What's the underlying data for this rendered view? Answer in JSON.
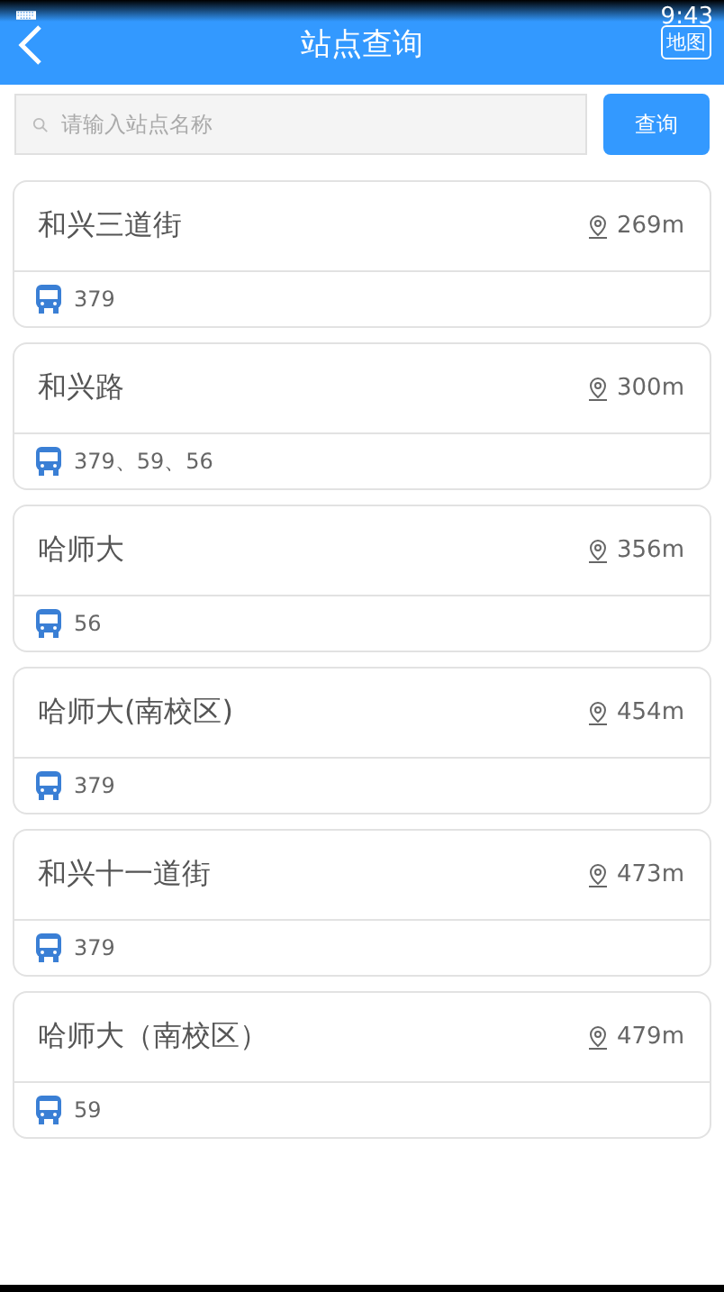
{
  "status_bar": {
    "time": "9:43"
  },
  "header": {
    "title": "站点查询",
    "map_button": "地图"
  },
  "search": {
    "placeholder": "请输入站点名称",
    "button": "查询"
  },
  "stations": [
    {
      "name": "和兴三道街",
      "distance": "269m",
      "routes": "379"
    },
    {
      "name": "和兴路",
      "distance": "300m",
      "routes": "379、59、56"
    },
    {
      "name": "哈师大",
      "distance": "356m",
      "routes": "56"
    },
    {
      "name": "哈师大(南校区)",
      "distance": "454m",
      "routes": "379"
    },
    {
      "name": "和兴十一道街",
      "distance": "473m",
      "routes": "379"
    },
    {
      "name": "哈师大（南校区）",
      "distance": "479m",
      "routes": "59"
    }
  ]
}
